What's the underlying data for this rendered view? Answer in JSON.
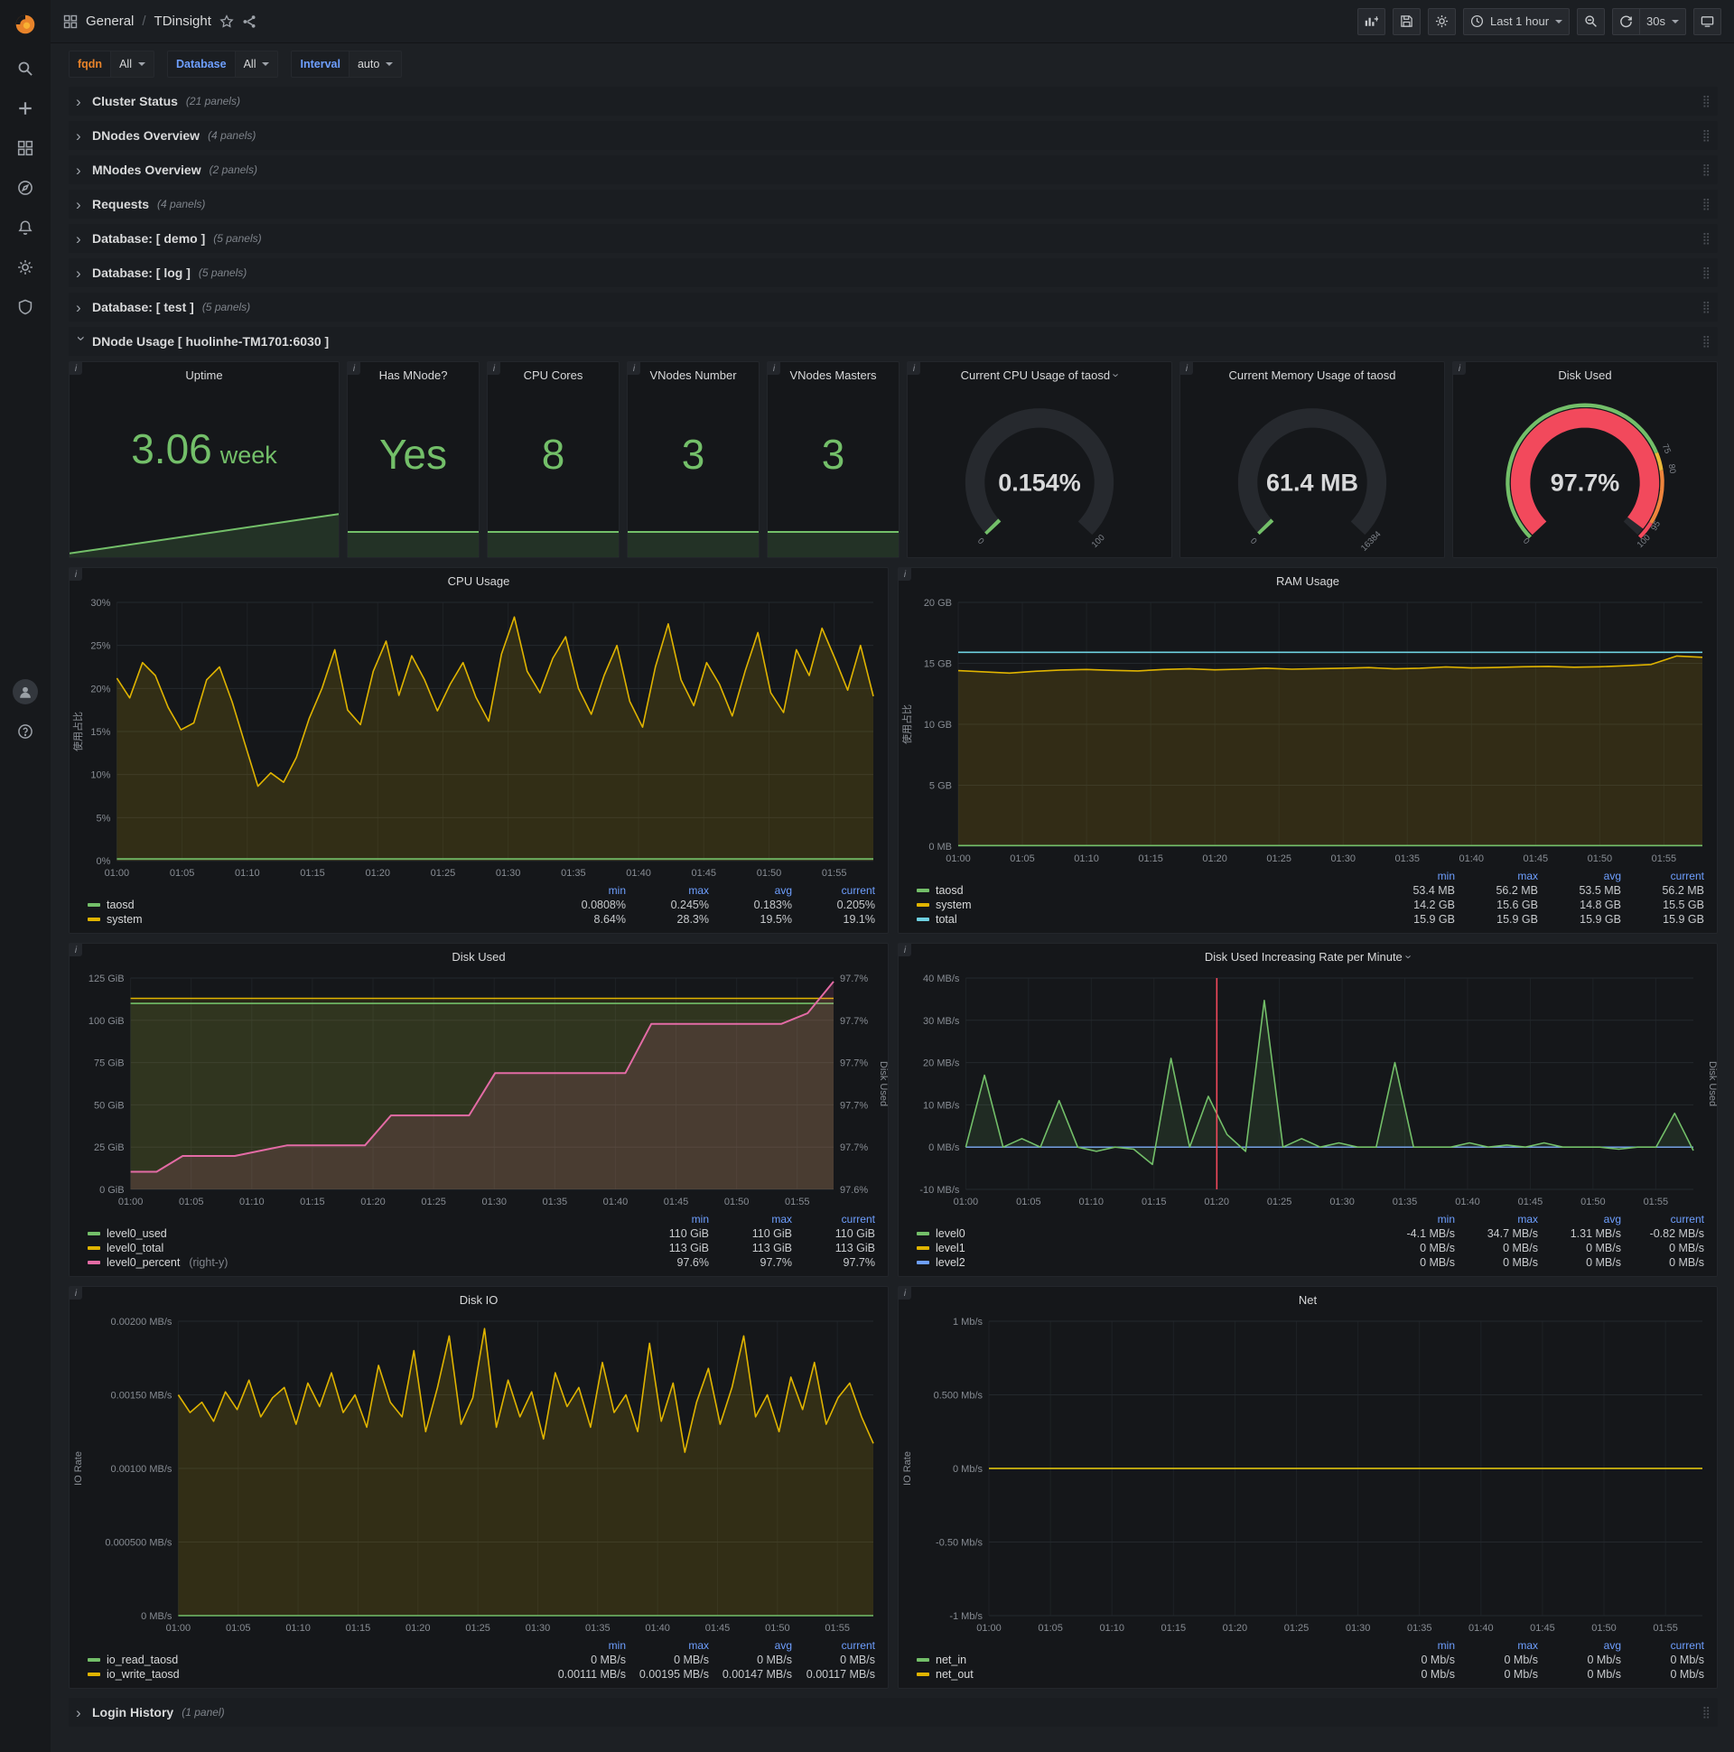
{
  "nav": {
    "breadcrumb": {
      "section": "General",
      "separator": "/",
      "page": "TDinsight"
    },
    "time_range_label": "Last 1 hour",
    "refresh_interval_label": "30s"
  },
  "variables": [
    {
      "label": "fqdn",
      "value": "All",
      "label_color": "#e8832a"
    },
    {
      "label": "Database",
      "value": "All",
      "label_color": "#6e9fff"
    },
    {
      "label": "Interval",
      "value": "auto",
      "label_color": "#6e9fff"
    }
  ],
  "rows": [
    {
      "title": "Cluster Status",
      "count": "(21 panels)"
    },
    {
      "title": "DNodes Overview",
      "count": "(4 panels)"
    },
    {
      "title": "MNodes Overview",
      "count": "(2 panels)"
    },
    {
      "title": "Requests",
      "count": "(4 panels)"
    },
    {
      "title": "Database: [ demo ]",
      "count": "(5 panels)"
    },
    {
      "title": "Database: [ log ]",
      "count": "(5 panels)"
    },
    {
      "title": "Database: [ test ]",
      "count": "(5 panels)"
    }
  ],
  "expanded_row": {
    "title": "DNode Usage [ huolinhe-TM1701:6030 ]"
  },
  "bottom_row": {
    "title": "Login History",
    "count": "(1 panel)"
  },
  "stats": [
    {
      "title": "Uptime",
      "value": "3.06",
      "unit": "week",
      "spark": [
        2.99,
        3.0,
        3.01,
        3.02,
        3.03,
        3.04,
        3.05,
        3.06
      ],
      "spark_h": 52
    },
    {
      "title": "Has MNode?",
      "value": "Yes",
      "unit": "",
      "spark": [
        1,
        1
      ],
      "spark_h": 40
    },
    {
      "title": "CPU Cores",
      "value": "8",
      "unit": "",
      "spark": [
        8,
        8
      ],
      "spark_h": 40
    },
    {
      "title": "VNodes Number",
      "value": "3",
      "unit": "",
      "spark": [
        3,
        3
      ],
      "spark_h": 40
    },
    {
      "title": "VNodes Masters",
      "value": "3",
      "unit": "",
      "spark": [
        3,
        3
      ],
      "spark_h": 40
    }
  ],
  "gauges": [
    {
      "title": "Current CPU Usage of taosd",
      "value": "0.154%",
      "fraction": 0.00154,
      "color": "#73bf69",
      "value_color": "#d8d9da",
      "labels": [
        {
          "text": "0",
          "frac": 0
        },
        {
          "text": "100",
          "frac": 1
        }
      ]
    },
    {
      "title": "Current Memory Usage of taosd",
      "value": "61.4 MB",
      "fraction": 0.00375,
      "color": "#73bf69",
      "value_color": "#d8d9da",
      "labels": [
        {
          "text": "0",
          "frac": 0
        },
        {
          "text": "16384",
          "frac": 1
        }
      ]
    },
    {
      "title": "Disk Used",
      "value": "97.7%",
      "fraction": 0.977,
      "color": "#f2495c",
      "value_color": "#f2495c",
      "labels": [
        {
          "text": "0",
          "frac": 0
        },
        {
          "text": "75",
          "frac": 0.75
        },
        {
          "text": "80",
          "frac": 0.8
        },
        {
          "text": "95",
          "frac": 0.95
        },
        {
          "text": "100",
          "frac": 1
        }
      ],
      "bands": [
        {
          "from": 0,
          "to": 0.75,
          "color": "#73bf69"
        },
        {
          "from": 0.75,
          "to": 0.8,
          "color": "#eab839"
        },
        {
          "from": 0.8,
          "to": 0.95,
          "color": "#ef843c"
        },
        {
          "from": 0.95,
          "to": 1,
          "color": "#f2495c"
        }
      ]
    }
  ],
  "charts": {
    "cpu": {
      "type": "line",
      "title": "CPU Usage",
      "y_label": "使用占比",
      "ymin": 0,
      "ymax": 30,
      "y_ticks": [
        "0%",
        "5%",
        "10%",
        "15%",
        "20%",
        "25%",
        "30%"
      ],
      "x_ticks": [
        "01:00",
        "01:05",
        "01:10",
        "01:15",
        "01:20",
        "01:25",
        "01:30",
        "01:35",
        "01:40",
        "01:45",
        "01:50",
        "01:55"
      ],
      "series": [
        {
          "name": "system",
          "color": "#e0b400",
          "width": 1.6,
          "fill": "rgba(224,180,0,0.15)",
          "values": [
            21.2,
            18.9,
            23.0,
            21.5,
            17.8,
            15.2,
            16.0,
            21.0,
            22.5,
            18.4,
            13.5,
            8.64,
            10.2,
            9.1,
            12.0,
            16.5,
            20.0,
            24.5,
            17.5,
            15.8,
            22.0,
            25.5,
            19.2,
            23.8,
            21.0,
            17.4,
            20.5,
            23.0,
            19.0,
            16.2,
            24.0,
            28.3,
            22.0,
            19.5,
            23.5,
            26.0,
            20.0,
            17.0,
            21.5,
            25.0,
            18.5,
            15.5,
            22.5,
            27.5,
            21.0,
            18.0,
            23.0,
            20.5,
            16.8,
            22.0,
            26.5,
            19.5,
            17.2,
            24.5,
            21.5,
            27.0,
            23.5,
            19.8,
            25.0,
            19.1
          ]
        },
        {
          "name": "taosd",
          "color": "#73bf69",
          "width": 1.6,
          "fill": "rgba(115,191,105,0.08)",
          "values": [
            0.2,
            0.2
          ]
        }
      ],
      "legend": {
        "cols": [
          "min",
          "max",
          "avg",
          "current"
        ],
        "rows": [
          {
            "name": "taosd",
            "color": "#73bf69",
            "vals": [
              "0.0808%",
              "0.245%",
              "0.183%",
              "0.205%"
            ]
          },
          {
            "name": "system",
            "color": "#e0b400",
            "vals": [
              "8.64%",
              "28.3%",
              "19.5%",
              "19.1%"
            ]
          }
        ]
      }
    },
    "ram": {
      "type": "line",
      "title": "RAM Usage",
      "y_label": "使用占比",
      "ymin": 0,
      "ymax": 20,
      "y_ticks": [
        "0 MB",
        "5 GB",
        "10 GB",
        "15 GB",
        "20 GB"
      ],
      "x_ticks": [
        "01:00",
        "01:05",
        "01:10",
        "01:15",
        "01:20",
        "01:25",
        "01:30",
        "01:35",
        "01:40",
        "01:45",
        "01:50",
        "01:55"
      ],
      "series": [
        {
          "name": "system",
          "color": "#e0b400",
          "width": 1.6,
          "fill": "rgba(224,180,0,0.14)",
          "values": [
            14.4,
            14.3,
            14.2,
            14.35,
            14.45,
            14.5,
            14.42,
            14.38,
            14.5,
            14.55,
            14.47,
            14.52,
            14.6,
            14.52,
            14.56,
            14.6,
            14.65,
            14.55,
            14.6,
            14.7,
            14.62,
            14.66,
            14.72,
            14.75,
            14.68,
            14.72,
            14.8,
            14.9,
            15.6,
            15.5
          ]
        },
        {
          "name": "taosd",
          "color": "#73bf69",
          "width": 1.6,
          "fill": "rgba(115,191,105,0.10)",
          "values": [
            0.054,
            0.054
          ]
        },
        {
          "name": "total",
          "color": "#6ed0e0",
          "width": 1.6,
          "values": [
            15.9,
            15.9
          ]
        }
      ],
      "legend": {
        "cols": [
          "min",
          "max",
          "avg",
          "current"
        ],
        "rows": [
          {
            "name": "taosd",
            "color": "#73bf69",
            "vals": [
              "53.4 MB",
              "56.2 MB",
              "53.5 MB",
              "56.2 MB"
            ]
          },
          {
            "name": "system",
            "color": "#e0b400",
            "vals": [
              "14.2 GB",
              "15.6 GB",
              "14.8 GB",
              "15.5 GB"
            ]
          },
          {
            "name": "total",
            "color": "#6ed0e0",
            "vals": [
              "15.9 GB",
              "15.9 GB",
              "15.9 GB",
              "15.9 GB"
            ]
          }
        ]
      }
    },
    "disk_used": {
      "type": "line",
      "title": "Disk Used",
      "ymin": 0,
      "ymax": 125,
      "y_ticks": [
        "0 GiB",
        "25 GiB",
        "50 GiB",
        "75 GiB",
        "100 GiB",
        "125 GiB"
      ],
      "right_min": 97.59,
      "right_max": 97.71,
      "right_ticks": [
        "97.6%",
        "97.7%",
        "97.7%",
        "97.7%",
        "97.7%",
        "97.7%"
      ],
      "right_label": "Disk Used",
      "x_ticks": [
        "01:00",
        "01:05",
        "01:10",
        "01:15",
        "01:20",
        "01:25",
        "01:30",
        "01:35",
        "01:40",
        "01:45",
        "01:50",
        "01:55"
      ],
      "series": [
        {
          "name": "level0_total",
          "color": "#e0b400",
          "width": 1.6,
          "fill": "rgba(224,180,0,0.10)",
          "values": [
            113,
            113
          ]
        },
        {
          "name": "level0_used",
          "color": "#73bf69",
          "width": 1.6,
          "fill": "rgba(115,191,105,0.10)",
          "values": [
            110,
            110
          ]
        },
        {
          "name": "level0_percent",
          "color": "#e36ba5",
          "width": 2,
          "axis": "right",
          "fill": "rgba(227,107,165,0.14)",
          "values": [
            97.6,
            97.6,
            97.609,
            97.609,
            97.609,
            97.612,
            97.615,
            97.615,
            97.615,
            97.615,
            97.632,
            97.632,
            97.632,
            97.632,
            97.656,
            97.656,
            97.656,
            97.656,
            97.656,
            97.656,
            97.684,
            97.684,
            97.684,
            97.684,
            97.684,
            97.684,
            97.69,
            97.708
          ]
        }
      ],
      "legend": {
        "cols": [
          "min",
          "max",
          "current"
        ],
        "rows": [
          {
            "name": "level0_used",
            "color": "#73bf69",
            "vals": [
              "110 GiB",
              "110 GiB",
              "110 GiB"
            ]
          },
          {
            "name": "level0_total",
            "color": "#e0b400",
            "vals": [
              "113 GiB",
              "113 GiB",
              "113 GiB"
            ]
          },
          {
            "name": "level0_percent",
            "color": "#e36ba5",
            "suffix": "(right-y)",
            "vals": [
              "97.6%",
              "97.7%",
              "97.7%"
            ]
          }
        ]
      }
    },
    "disk_rate": {
      "type": "line",
      "title": "Disk Used Increasing Rate per Minute",
      "ymin": -10,
      "ymax": 40,
      "y_ticks": [
        "-10 MB/s",
        "0 MB/s",
        "10 MB/s",
        "20 MB/s",
        "30 MB/s",
        "40 MB/s"
      ],
      "right_label": "Disk Used",
      "annotation": 0.345,
      "x_ticks": [
        "01:00",
        "01:05",
        "01:10",
        "01:15",
        "01:20",
        "01:25",
        "01:30",
        "01:35",
        "01:40",
        "01:45",
        "01:50",
        "01:55"
      ],
      "series": [
        {
          "name": "level1",
          "color": "#e0b400",
          "width": 1.4,
          "values": [
            0,
            0
          ]
        },
        {
          "name": "level2",
          "color": "#6e9fff",
          "width": 1.4,
          "values": [
            0,
            0
          ]
        },
        {
          "name": "level0",
          "color": "#73bf69",
          "width": 1.6,
          "fill": "rgba(115,191,105,0.12)",
          "values": [
            0,
            17,
            0,
            2,
            0,
            11,
            0,
            -1,
            0,
            -0.5,
            -4.1,
            21,
            0,
            12,
            3,
            -1,
            34.7,
            0,
            2,
            0,
            1,
            0,
            0,
            20,
            0,
            0,
            0,
            1,
            0,
            0.5,
            0,
            1,
            0,
            0,
            0,
            -0.5,
            0,
            0,
            8,
            -0.82
          ]
        }
      ],
      "legend": {
        "cols": [
          "min",
          "max",
          "avg",
          "current"
        ],
        "rows": [
          {
            "name": "level0",
            "color": "#73bf69",
            "vals": [
              "-4.1 MB/s",
              "34.7 MB/s",
              "1.31 MB/s",
              "-0.82 MB/s"
            ]
          },
          {
            "name": "level1",
            "color": "#e0b400",
            "vals": [
              "0 MB/s",
              "0 MB/s",
              "0 MB/s",
              "0 MB/s"
            ]
          },
          {
            "name": "level2",
            "color": "#6e9fff",
            "vals": [
              "0 MB/s",
              "0 MB/s",
              "0 MB/s",
              "0 MB/s"
            ]
          }
        ]
      }
    },
    "disk_io": {
      "type": "line",
      "title": "Disk IO",
      "y_label": "IO Rate",
      "ymin": 0,
      "ymax": 0.002,
      "y_ticks": [
        "0 MB/s",
        "0.000500 MB/s",
        "0.00100 MB/s",
        "0.00150 MB/s",
        "0.00200 MB/s"
      ],
      "x_ticks": [
        "01:00",
        "01:05",
        "01:10",
        "01:15",
        "01:20",
        "01:25",
        "01:30",
        "01:35",
        "01:40",
        "01:45",
        "01:50",
        "01:55"
      ],
      "series": [
        {
          "name": "io_write_taosd",
          "color": "#e0b400",
          "width": 1.6,
          "fill": "rgba(224,180,0,0.15)",
          "values": [
            0.0015,
            0.00138,
            0.00145,
            0.00132,
            0.00152,
            0.0014,
            0.0016,
            0.00135,
            0.00148,
            0.00155,
            0.0013,
            0.00158,
            0.00142,
            0.00165,
            0.00138,
            0.0015,
            0.00128,
            0.0017,
            0.00145,
            0.00135,
            0.0018,
            0.00125,
            0.00155,
            0.0019,
            0.0013,
            0.00148,
            0.00195,
            0.00128,
            0.0016,
            0.00135,
            0.00152,
            0.0012,
            0.00165,
            0.00142,
            0.00155,
            0.00128,
            0.00172,
            0.00138,
            0.0015,
            0.00125,
            0.00185,
            0.00132,
            0.00158,
            0.00111,
            0.00145,
            0.00168,
            0.0013,
            0.00155,
            0.0019,
            0.00135,
            0.0015,
            0.00125,
            0.00162,
            0.0014,
            0.00172,
            0.0013,
            0.00148,
            0.00158,
            0.00135,
            0.00117
          ]
        },
        {
          "name": "io_read_taosd",
          "color": "#73bf69",
          "width": 1.6,
          "values": [
            0,
            0
          ]
        }
      ],
      "legend": {
        "cols": [
          "min",
          "max",
          "avg",
          "current"
        ],
        "rows": [
          {
            "name": "io_read_taosd",
            "color": "#73bf69",
            "vals": [
              "0 MB/s",
              "0 MB/s",
              "0 MB/s",
              "0 MB/s"
            ]
          },
          {
            "name": "io_write_taosd",
            "color": "#e0b400",
            "vals": [
              "0.00111 MB/s",
              "0.00195 MB/s",
              "0.00147 MB/s",
              "0.00117 MB/s"
            ]
          }
        ]
      }
    },
    "net": {
      "type": "line",
      "title": "Net",
      "y_label": "IO Rate",
      "ymin": -1,
      "ymax": 1,
      "y_ticks": [
        "-1 Mb/s",
        "-0.50 Mb/s",
        "0 Mb/s",
        "0.500 Mb/s",
        "1 Mb/s"
      ],
      "x_ticks": [
        "01:00",
        "01:05",
        "01:10",
        "01:15",
        "01:20",
        "01:25",
        "01:30",
        "01:35",
        "01:40",
        "01:45",
        "01:50",
        "01:55"
      ],
      "series": [
        {
          "name": "net_in",
          "color": "#73bf69",
          "width": 1.6,
          "values": [
            0,
            0
          ]
        },
        {
          "name": "net_out",
          "color": "#e0b400",
          "width": 1.6,
          "values": [
            0,
            0
          ]
        }
      ],
      "legend": {
        "cols": [
          "min",
          "max",
          "avg",
          "current"
        ],
        "rows": [
          {
            "name": "net_in",
            "color": "#73bf69",
            "vals": [
              "0 Mb/s",
              "0 Mb/s",
              "0 Mb/s",
              "0 Mb/s"
            ]
          },
          {
            "name": "net_out",
            "color": "#e0b400",
            "vals": [
              "0 Mb/s",
              "0 Mb/s",
              "0 Mb/s",
              "0 Mb/s"
            ]
          }
        ]
      }
    }
  }
}
